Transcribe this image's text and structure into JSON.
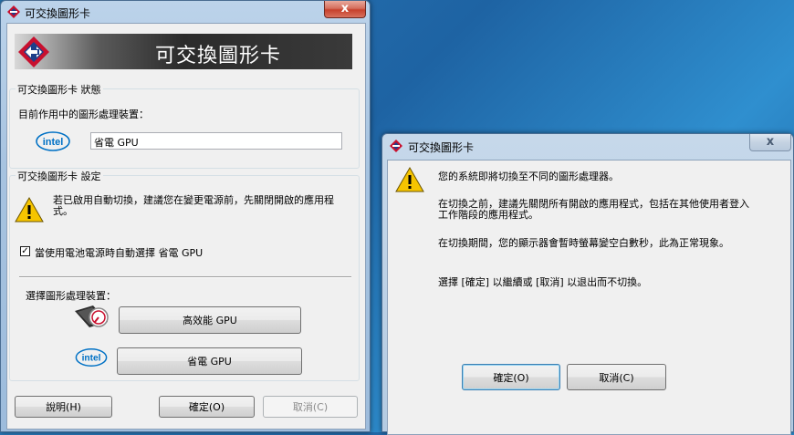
{
  "main_window": {
    "title": "可交換圖形卡",
    "close": "x",
    "banner_title": "可交換圖形卡",
    "status_group": {
      "label": "可交換圖形卡 狀態",
      "current_label": "目前作用中的圖形處理裝置：",
      "current_value": "省電 GPU"
    },
    "settings_group": {
      "label": "可交換圖形卡 設定",
      "warning_text": "若已啟用自動切換，建議您在變更電源前，先關閉開啟的應用程式。",
      "checkbox_checked": true,
      "checkbox_label": "當使用電池電源時自動選擇 省電 GPU",
      "select_label": "選擇圖形處理裝置：",
      "high_perf_button": "高效能 GPU",
      "power_save_button": "省電 GPU"
    },
    "buttons": {
      "help": "說明(H)",
      "ok": "確定(O)",
      "cancel": "取消(C)"
    }
  },
  "dialog": {
    "title": "可交換圖形卡",
    "close": "x",
    "message1": "您的系統即將切換至不同的圖形處理器。",
    "message2": "在切換之前，建議先關閉所有開啟的應用程式，包括在其他使用者登入工作階段的應用程式。",
    "message3": "在切換期間，您的顯示器會暫時螢幕變空白數秒，此為正常現象。",
    "message4": "選擇 [確定] 以繼續或 [取消] 以退出而不切換。",
    "ok": "確定(O)",
    "cancel": "取消(C)"
  },
  "colors": {
    "accent": "#3c7fb1",
    "desktop": "#2a79b8",
    "warning": "#f6c400"
  }
}
